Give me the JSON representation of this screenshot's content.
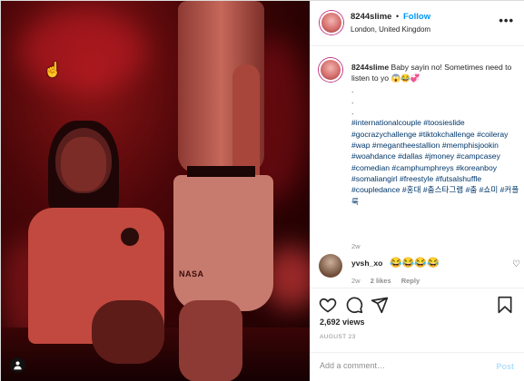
{
  "post": {
    "username": "8244slime",
    "follow_label": "Follow",
    "separator": "•",
    "location": "London, United Kingdom",
    "more_label": "•••"
  },
  "caption": {
    "username": "8244slime",
    "text": "Baby sayin no! Sometimes need to listen to yo 😱😂💞",
    "dot1": ".",
    "dot2": ".",
    "dot3": ".",
    "hashtags": "#internationalcouple #toosieslide #gocrazychallenge #tiktokchallenge #coileray #wap #megantheestallion #memphisjookin #woahdance #dallas #jmoney #campcasey #comedian #camphumphreys #koreanboy #somaliangirl #freestyle #futsalshuffle #coupledance #홍대 #춤스타그램 #춤 #쇼미 #커플룩",
    "time": "2w"
  },
  "comment": {
    "username": "yvsh_xo",
    "text": "😂😂😂😂",
    "time": "2w",
    "likes": "2 likes",
    "reply": "Reply"
  },
  "actions": {
    "views": "2,692 views",
    "date": "AUGUST 23",
    "add_placeholder": "Add a comment…",
    "post_label": "Post"
  },
  "video": {
    "shorts_text": "NASA",
    "user_tag_icon": "user-icon"
  },
  "colors": {
    "accent": "#0095f6",
    "hashtag": "#00376b",
    "muted": "#8e8e8e",
    "post_disabled": "#b2dffc"
  }
}
